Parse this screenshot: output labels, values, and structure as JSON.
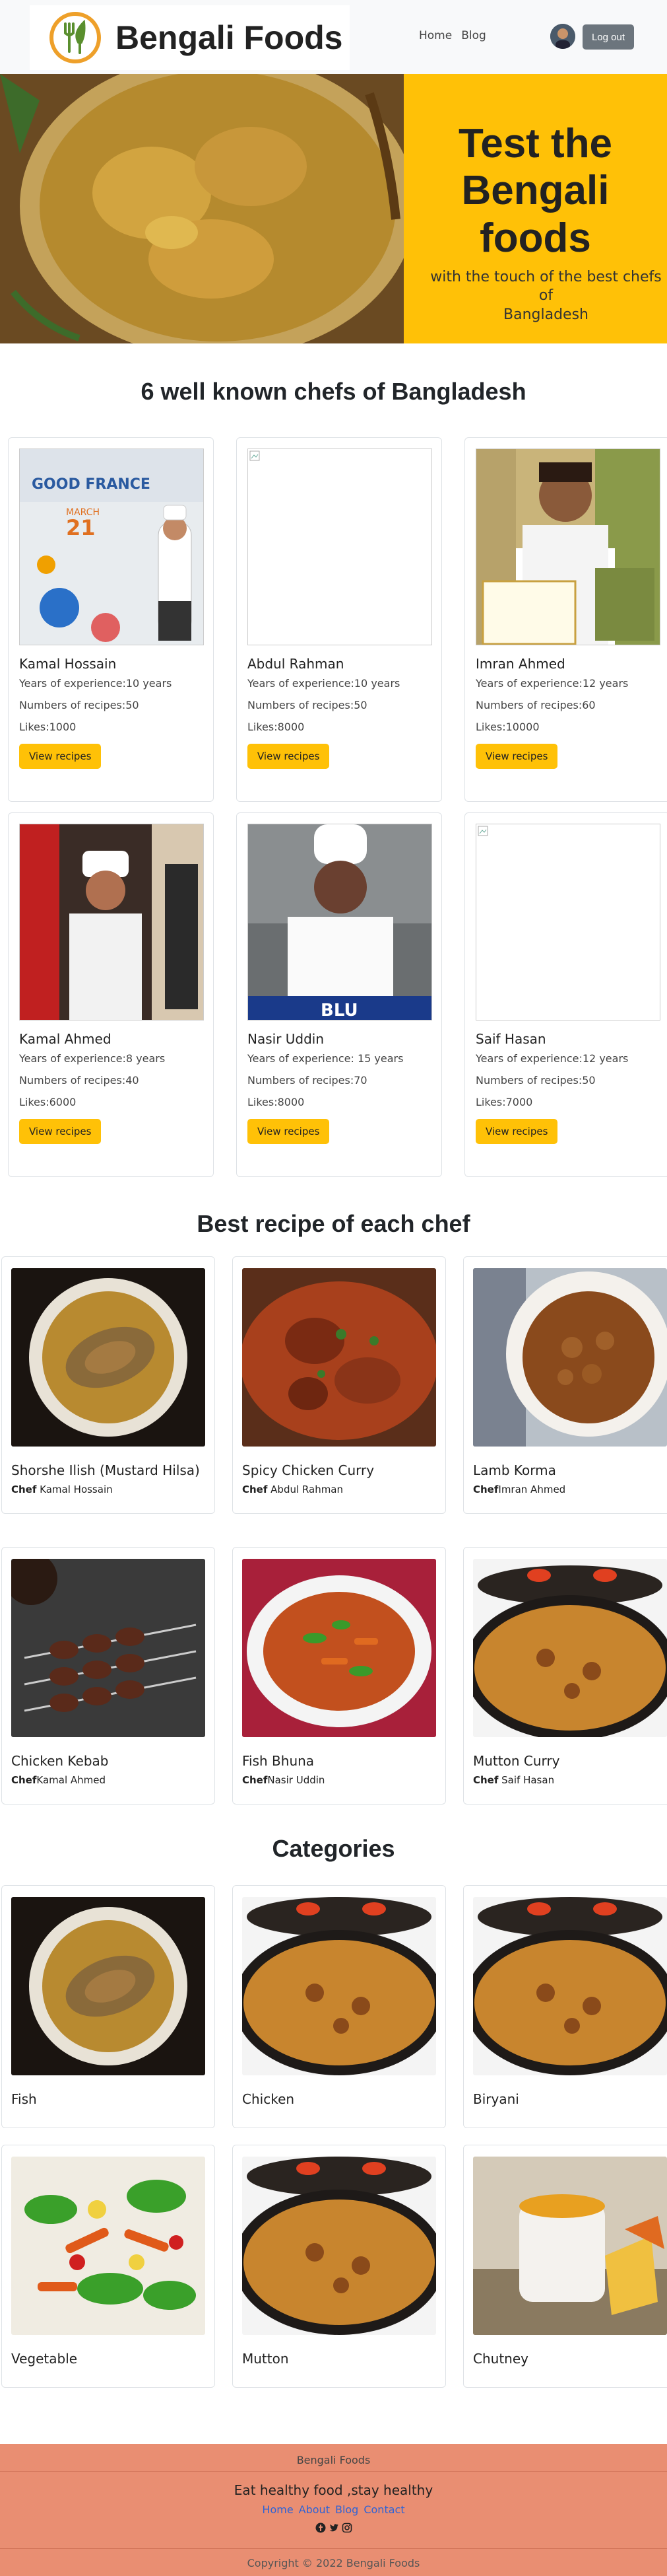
{
  "brand": {
    "name": "Bengali Foods"
  },
  "nav": {
    "links": [
      "Home",
      "Blog"
    ],
    "logout_label": "Log out"
  },
  "hero": {
    "title": "Test the Bengali foods",
    "subtitle": "with the touch of the best chefs of\nBangladesh"
  },
  "chefs_section": {
    "title": "6 well known chefs of Bangladesh"
  },
  "chefs": [
    {
      "name": "Kamal Hossain",
      "experience": "Years of experience:10 years",
      "recipes": "Numbers of recipes:50",
      "likes": "Likes:1000",
      "button": "View recipes"
    },
    {
      "name": "Abdul Rahman",
      "experience": "Years of experience:10 years",
      "recipes": "Numbers of recipes:50",
      "likes": "Likes:8000",
      "button": "View recipes"
    },
    {
      "name": "Imran Ahmed",
      "experience": "Years of experience:12 years",
      "recipes": "Numbers of recipes:60",
      "likes": "Likes:10000",
      "button": "View recipes"
    },
    {
      "name": "Kamal Ahmed",
      "experience": "Years of experience:8 years",
      "recipes": "Numbers of recipes:40",
      "likes": "Likes:6000",
      "button": "View recipes"
    },
    {
      "name": "Nasir Uddin",
      "experience": "Years of experience: 15 years",
      "recipes": "Numbers of recipes:70",
      "likes": "Likes:8000",
      "button": "View recipes"
    },
    {
      "name": "Saif Hasan",
      "experience": "Years of experience:12 years",
      "recipes": "Numbers of recipes:50",
      "likes": "Likes:7000",
      "button": "View recipes"
    }
  ],
  "chef_photo_texts": {
    "good_france": "GOOD FRANCE",
    "march": "MARCH",
    "day": "21",
    "blu": "BLU"
  },
  "recipes_section": {
    "title": "Best recipe of each chef"
  },
  "recipes": [
    {
      "title": "Shorshe Ilish (Mustard Hilsa)",
      "chef_label": "Chef",
      "chef_name": " Kamal Hossain"
    },
    {
      "title": "Spicy Chicken Curry",
      "chef_label": "Chef",
      "chef_name": " Abdul Rahman"
    },
    {
      "title": "Lamb Korma",
      "chef_label": "Chef",
      "chef_name": "Imran Ahmed"
    },
    {
      "title": "Chicken Kebab",
      "chef_label": "Chef",
      "chef_name": "Kamal Ahmed"
    },
    {
      "title": "Fish Bhuna",
      "chef_label": "Chef",
      "chef_name": "Nasir Uddin"
    },
    {
      "title": "Mutton Curry",
      "chef_label": "Chef",
      "chef_name": " Saif Hasan"
    }
  ],
  "categories_section": {
    "title": "Categories"
  },
  "categories": [
    {
      "title": "Fish"
    },
    {
      "title": "Chicken"
    },
    {
      "title": "Biryani"
    },
    {
      "title": "Vegetable"
    },
    {
      "title": "Mutton"
    },
    {
      "title": "Chutney"
    }
  ],
  "footer": {
    "top": "Bengali Foods",
    "motto": "Eat healthy food ,stay healthy",
    "links": [
      "Home",
      "About",
      "Blog",
      "Contact"
    ],
    "social_icons": [
      "facebook-icon",
      "twitter-icon",
      "instagram-icon"
    ],
    "copyright": "Copyright © 2022 Bengali Foods"
  },
  "colors": {
    "accent": "#ffc107",
    "footer_bg": "#e98e72",
    "link": "#2f63d6"
  }
}
